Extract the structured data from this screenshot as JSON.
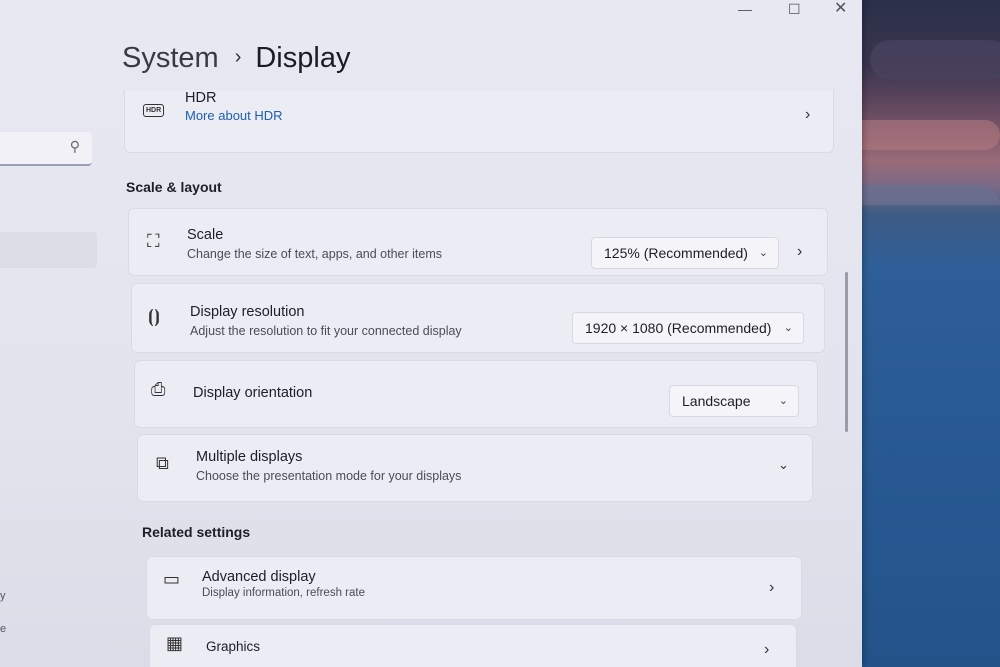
{
  "breadcrumb": {
    "parent": "System",
    "separator": "›",
    "current": "Display"
  },
  "window_controls": {
    "minimize": "—",
    "maximize": "☐",
    "close": "✕"
  },
  "nav": {
    "search_icon": "search-icon",
    "fragment_1": "y",
    "fragment_2": "e"
  },
  "hdr": {
    "icon": "HDR",
    "title": "HDR",
    "link": "More about HDR"
  },
  "scale_layout": {
    "heading": "Scale & layout",
    "items": [
      {
        "title": "Scale",
        "sub": "Change the size of text, apps, and other items",
        "value": "125% (Recommended)"
      },
      {
        "title": "Display resolution",
        "sub": "Adjust the resolution to fit your connected display",
        "value": "1920 × 1080 (Recommended)"
      },
      {
        "title": "Display orientation",
        "sub": "",
        "value": "Landscape"
      },
      {
        "title": "Multiple displays",
        "sub": "Choose the presentation mode for your displays",
        "value": ""
      }
    ]
  },
  "related": {
    "heading": "Related settings",
    "items": [
      {
        "title": "Advanced display",
        "sub": "Display information, refresh rate"
      },
      {
        "title": "Graphics",
        "sub": ""
      }
    ]
  },
  "glyphs": {
    "chevron_right": "›",
    "chevron_down": "⌄"
  }
}
